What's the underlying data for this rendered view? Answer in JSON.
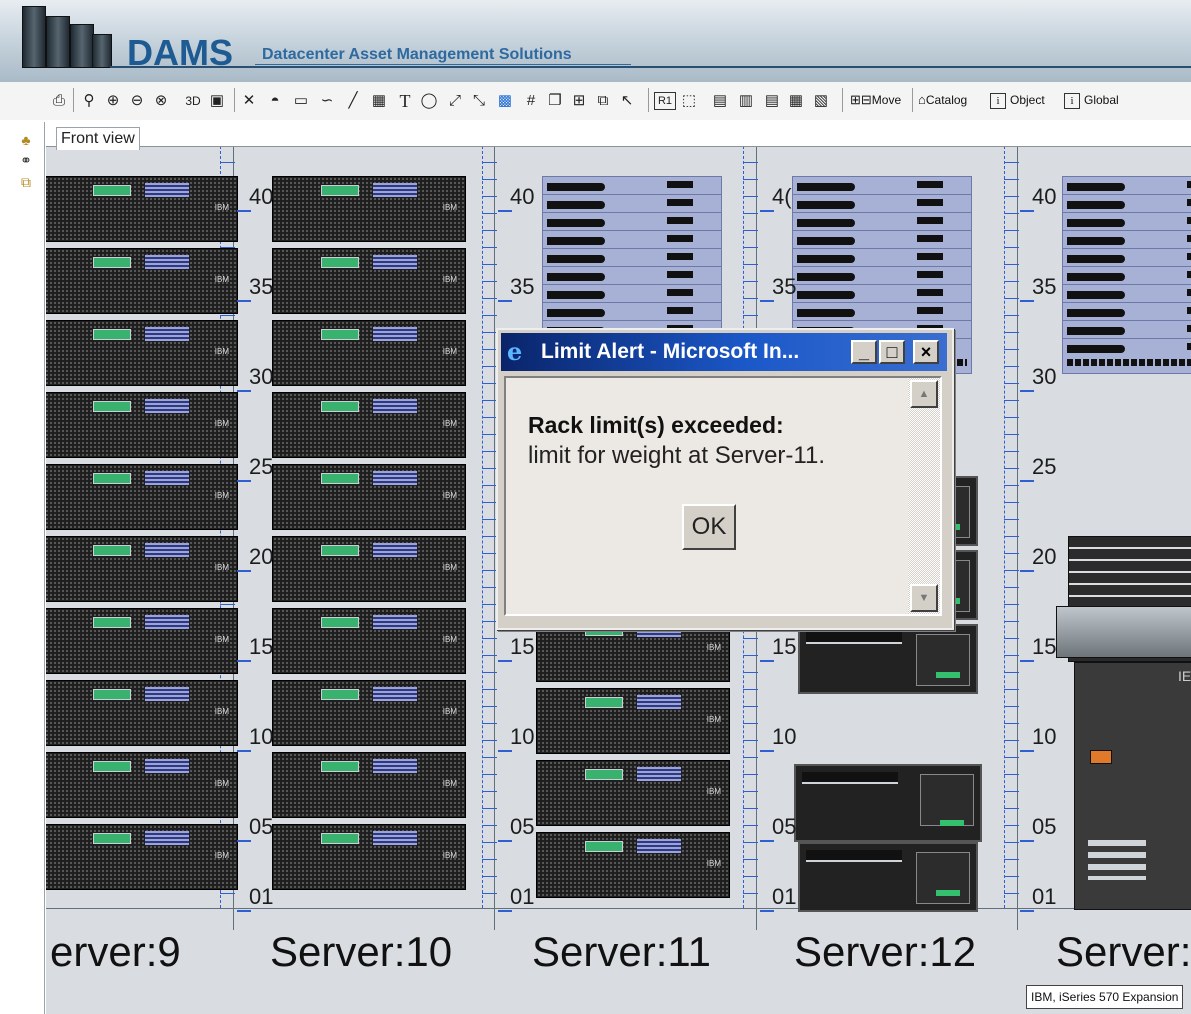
{
  "header": {
    "brand": "DAMS",
    "tagline": "Datacenter Asset Management Solutions"
  },
  "toolbar": {
    "icons": [
      "printer-icon",
      "zoom-icon",
      "zoom-in-icon",
      "zoom-out-icon",
      "zoom-fit-icon",
      "3d-icon",
      "camera-icon",
      "delete-icon",
      "paint-bucket-icon",
      "rectangle-icon",
      "curve-icon",
      "line-icon",
      "table-icon",
      "text-icon",
      "ellipse-icon",
      "connector-icon",
      "connector2-icon",
      "image-icon",
      "grid-icon",
      "copy-icon",
      "group-icon",
      "ungroup-icon",
      "pointer-icon",
      "r1-icon",
      "box-3d-icon",
      "rack-icon",
      "rack2-icon",
      "rack3-icon",
      "device-icon",
      "device2-icon"
    ],
    "three_d_label": "3D",
    "text_tool_label": "T",
    "r1_label": "R1",
    "move_label": "Move",
    "catalog_label": "Catalog",
    "object_label": "Object",
    "global_label": "Global",
    "info_glyph": "i"
  },
  "view": {
    "tab_label": "Front view"
  },
  "racks": [
    {
      "name": "erver:9",
      "type": "server"
    },
    {
      "name": "Server:10",
      "type": "server"
    },
    {
      "name": "Server:11",
      "type": "mixed"
    },
    {
      "name": "Server:12",
      "type": "iseries"
    },
    {
      "name": "Server:",
      "type": "expansion"
    }
  ],
  "u_labels": {
    "rack2": [
      "40",
      "35",
      "30",
      "25",
      "20",
      "15",
      "10",
      "05",
      "01"
    ],
    "rack3": [
      "40",
      "35",
      "",
      "",
      "",
      "15",
      "10",
      "05",
      "01"
    ],
    "rack4": [
      "4(",
      "35",
      "",
      "",
      "",
      "15",
      "10",
      "05",
      "01"
    ],
    "rack5": [
      "40",
      "35",
      "30",
      "25",
      "20",
      "15",
      "10",
      "05",
      "01"
    ],
    "rack1": [
      "40",
      "35",
      "30",
      "25",
      "20",
      "15",
      "10",
      "05",
      "01"
    ]
  },
  "device_logo": "IBM",
  "tooltip": "IBM, iSeries 570 Expansion",
  "dialog": {
    "title": "Limit Alert - Microsoft In...",
    "heading": "Rack limit(s) exceeded:",
    "message": "limit for weight at Server-11.",
    "ok_label": "OK",
    "minimize_glyph": "_",
    "maximize_glyph": "□",
    "close_glyph": "×",
    "scroll_up_glyph": "▲",
    "scroll_down_glyph": "▼",
    "ie_glyph": "e"
  },
  "left_tools": [
    "tree-icon",
    "binoculars-icon",
    "windows-icon"
  ]
}
